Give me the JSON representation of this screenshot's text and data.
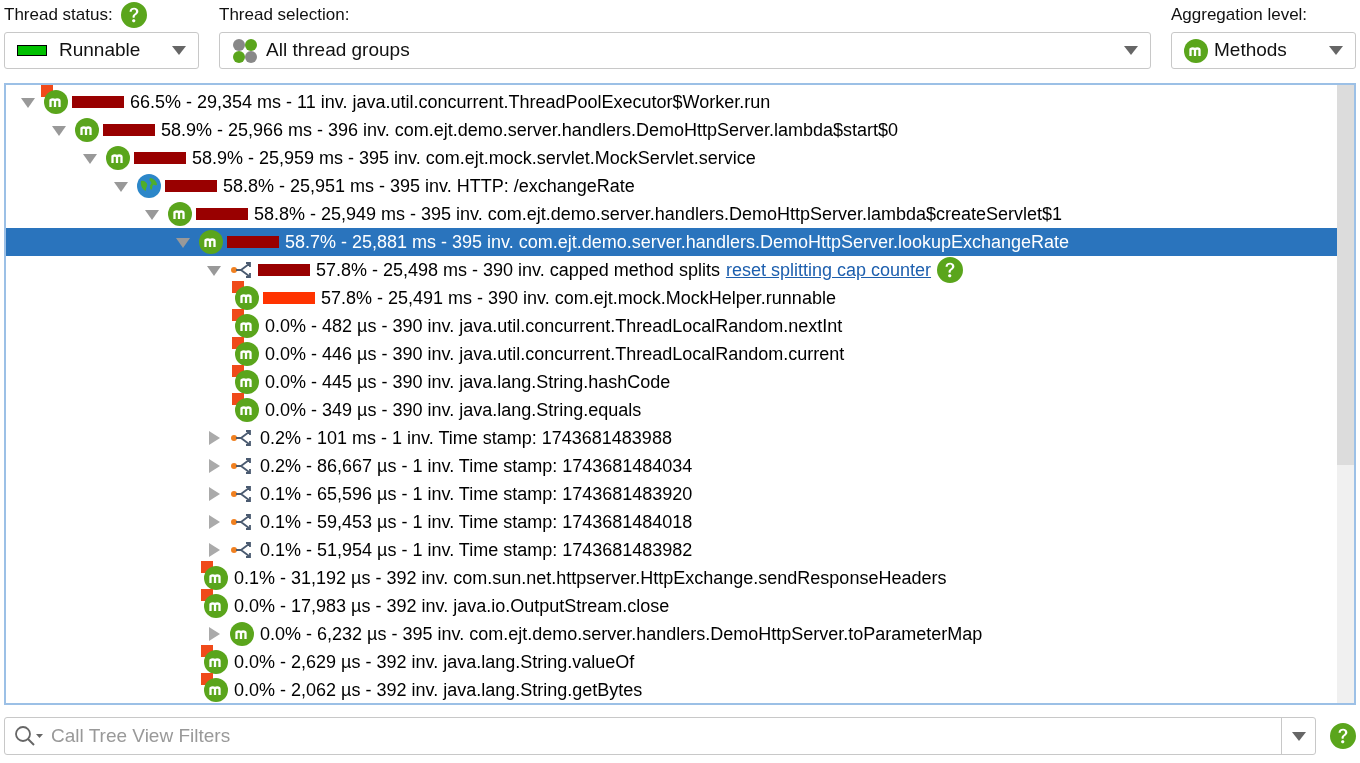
{
  "toolbar": {
    "thread_status": {
      "label": "Thread status:",
      "value": "Runnable",
      "color": "#00c000"
    },
    "thread_selection": {
      "label": "Thread selection:",
      "value": "All thread groups"
    },
    "aggregation": {
      "label": "Aggregation level:",
      "value": "Methods"
    }
  },
  "tree": [
    {
      "kind": "method",
      "flag": true,
      "expanded": true,
      "selected": false,
      "color": "#990000",
      "text": "66.5% - 29,354 ms - 11 inv. java.util.concurrent.ThreadPoolExecutor$Worker.run",
      "children": [
        {
          "kind": "method",
          "flag": false,
          "expanded": true,
          "selected": false,
          "color": "#990000",
          "text": "58.9% - 25,966 ms - 396 inv. com.ejt.demo.server.handlers.DemoHttpServer.lambda$start$0",
          "children": [
            {
              "kind": "method",
              "flag": false,
              "expanded": true,
              "selected": false,
              "color": "#990000",
              "text": "58.9% - 25,959 ms - 395 inv. com.ejt.mock.servlet.MockServlet.service",
              "children": [
                {
                  "kind": "web",
                  "flag": false,
                  "expanded": true,
                  "selected": false,
                  "color": "#990000",
                  "text": "58.8% - 25,951 ms - 395 inv. HTTP: /exchangeRate",
                  "children": [
                    {
                      "kind": "method",
                      "flag": false,
                      "expanded": true,
                      "selected": false,
                      "color": "#990000",
                      "text": "58.8% - 25,949 ms - 395 inv. com.ejt.demo.server.handlers.DemoHttpServer.lambda$createServlet$1",
                      "children": [
                        {
                          "kind": "method",
                          "flag": false,
                          "expanded": true,
                          "selected": true,
                          "color": "#990000",
                          "text": "58.7% - 25,881 ms - 395 inv. com.ejt.demo.server.handlers.DemoHttpServer.lookupExchangeRate",
                          "children": [
                            {
                              "kind": "split",
                              "flag": false,
                              "expanded": true,
                              "selected": false,
                              "color": "#990000",
                              "text": "57.8% - 25,498 ms - 390 inv. capped method splits",
                              "link": "reset splitting cap counter",
                              "help": true,
                              "children": [
                                {
                                  "kind": "method",
                                  "flag": true,
                                  "selected": false,
                                  "color": "#ff3300",
                                  "text": "57.8% - 25,491 ms - 390 inv. com.ejt.mock.MockHelper.runnable"
                                },
                                {
                                  "kind": "method",
                                  "flag": true,
                                  "selected": false,
                                  "text": "0.0% - 482 µs - 390 inv. java.util.concurrent.ThreadLocalRandom.nextInt"
                                },
                                {
                                  "kind": "method",
                                  "flag": true,
                                  "selected": false,
                                  "text": "0.0% - 446 µs - 390 inv. java.util.concurrent.ThreadLocalRandom.current"
                                },
                                {
                                  "kind": "method",
                                  "flag": true,
                                  "selected": false,
                                  "text": "0.0% - 445 µs - 390 inv. java.lang.String.hashCode"
                                },
                                {
                                  "kind": "method",
                                  "flag": true,
                                  "selected": false,
                                  "text": "0.0% - 349 µs - 390 inv. java.lang.String.equals"
                                }
                              ]
                            },
                            {
                              "kind": "split",
                              "flag": false,
                              "expanded": false,
                              "selected": false,
                              "text": "0.2% - 101 ms - 1 inv. Time stamp: 1743681483988"
                            },
                            {
                              "kind": "split",
                              "flag": false,
                              "expanded": false,
                              "selected": false,
                              "text": "0.2% - 86,667 µs - 1 inv. Time stamp: 1743681484034"
                            },
                            {
                              "kind": "split",
                              "flag": false,
                              "expanded": false,
                              "selected": false,
                              "text": "0.1% - 65,596 µs - 1 inv. Time stamp: 1743681483920"
                            },
                            {
                              "kind": "split",
                              "flag": false,
                              "expanded": false,
                              "selected": false,
                              "text": "0.1% - 59,453 µs - 1 inv. Time stamp: 1743681484018"
                            },
                            {
                              "kind": "split",
                              "flag": false,
                              "expanded": false,
                              "selected": false,
                              "text": "0.1% - 51,954 µs - 1 inv. Time stamp: 1743681483982"
                            },
                            {
                              "kind": "method",
                              "flag": true,
                              "selected": false,
                              "text": "0.1% - 31,192 µs - 392 inv. com.sun.net.httpserver.HttpExchange.sendResponseHeaders"
                            },
                            {
                              "kind": "method",
                              "flag": true,
                              "selected": false,
                              "text": "0.0% - 17,983 µs - 392 inv. java.io.OutputStream.close"
                            },
                            {
                              "kind": "method",
                              "flag": false,
                              "expanded": false,
                              "selected": false,
                              "text": "0.0% - 6,232 µs - 395 inv. com.ejt.demo.server.handlers.DemoHttpServer.toParameterMap"
                            },
                            {
                              "kind": "method",
                              "flag": true,
                              "selected": false,
                              "text": "0.0% - 2,629 µs - 392 inv. java.lang.String.valueOf"
                            },
                            {
                              "kind": "method",
                              "flag": true,
                              "selected": false,
                              "text": "0.0% - 2,062 µs - 392 inv. java.lang.String.getBytes"
                            }
                          ]
                        }
                      ]
                    }
                  ]
                }
              ]
            }
          ]
        }
      ]
    }
  ],
  "filter": {
    "placeholder": "Call Tree View Filters"
  }
}
